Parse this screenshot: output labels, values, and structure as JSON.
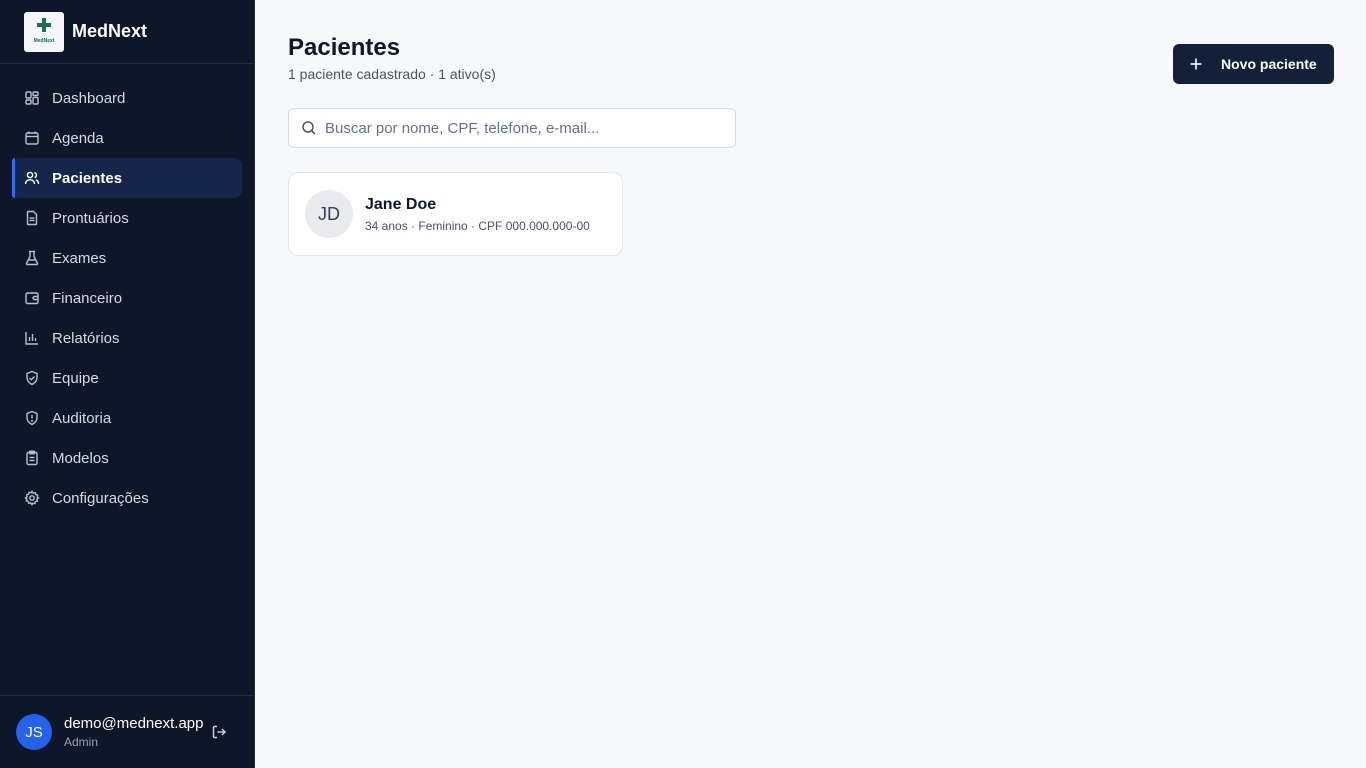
{
  "app": {
    "name": "MedNext",
    "logo_text": "MedNext"
  },
  "sidebar": {
    "items": [
      {
        "label": "Dashboard",
        "icon": "dashboard-grid-icon"
      },
      {
        "label": "Agenda",
        "icon": "calendar-icon"
      },
      {
        "label": "Pacientes",
        "icon": "users-icon",
        "active": true
      },
      {
        "label": "Prontuários",
        "icon": "document-icon"
      },
      {
        "label": "Exames",
        "icon": "flask-icon"
      },
      {
        "label": "Financeiro",
        "icon": "wallet-icon"
      },
      {
        "label": "Relatórios",
        "icon": "bar-chart-icon"
      },
      {
        "label": "Equipe",
        "icon": "shield-check-icon"
      },
      {
        "label": "Auditoria",
        "icon": "shield-alert-icon"
      },
      {
        "label": "Modelos",
        "icon": "clipboard-icon"
      },
      {
        "label": "Configurações",
        "icon": "gear-icon"
      }
    ]
  },
  "user": {
    "initials": "JS",
    "email": "demo@mednext.app",
    "role": "Admin"
  },
  "page": {
    "title": "Pacientes",
    "subtitle": "1 paciente cadastrado · 1 ativo(s)",
    "new_button": "Novo paciente"
  },
  "search": {
    "placeholder": "Buscar por nome, CPF, telefone, e-mail...",
    "value": ""
  },
  "patients": [
    {
      "initials": "JD",
      "name": "Jane Doe",
      "meta": "34 anos · Feminino · CPF 000.000.000-00"
    }
  ],
  "colors": {
    "sidebar_bg": "#0e1629",
    "accent": "#2f6ef0",
    "button_bg": "#142039",
    "avatar_bg": "#2563eb"
  }
}
